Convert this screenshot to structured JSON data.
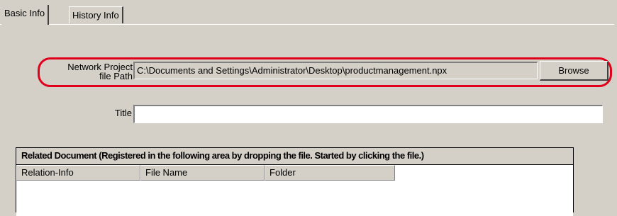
{
  "tabs": [
    {
      "label": "Basic Info",
      "active": true
    },
    {
      "label": "History Info",
      "active": false
    }
  ],
  "network_project": {
    "label_line1": "Network Project",
    "label_line2": "file Path",
    "path_value": "C:\\Documents and Settings\\Administrator\\Desktop\\productmanagement.npx",
    "browse_label": "Browse"
  },
  "title_field": {
    "label": "Title",
    "value": ""
  },
  "related_document": {
    "caption": "Related Document (Registered in the following area by dropping the file. Started by clicking the file.)",
    "columns": [
      "Relation-Info",
      "File Name",
      "Folder"
    ]
  },
  "colors": {
    "highlight": "#e0001b",
    "window_bg": "#d4d0c8"
  }
}
